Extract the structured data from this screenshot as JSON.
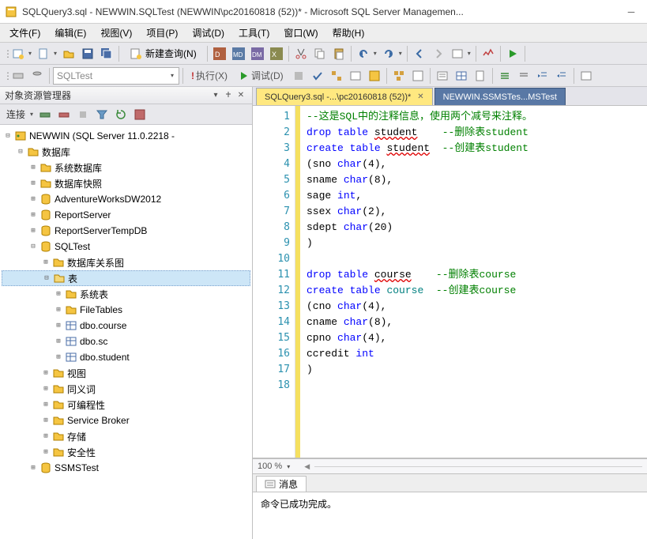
{
  "titlebar": {
    "text": "SQLQuery3.sql - NEWWIN.SQLTest (NEWWIN\\pc20160818 (52))* - Microsoft SQL Server Managemen..."
  },
  "menu": {
    "file": "文件(F)",
    "edit": "编辑(E)",
    "view": "视图(V)",
    "project": "项目(P)",
    "debug": "调试(D)",
    "tools": "工具(T)",
    "window": "窗口(W)",
    "help": "帮助(H)"
  },
  "toolbar1": {
    "new_query": "新建查询(N)"
  },
  "toolbar2": {
    "db_combo": "SQLTest",
    "execute": "执行(X)",
    "debug": "调试(D)"
  },
  "panel": {
    "title": "对象资源管理器",
    "connect_label": "连接"
  },
  "tree": {
    "server": "NEWWIN (SQL Server 11.0.2218 -",
    "databases": "数据库",
    "sys_db": "系统数据库",
    "db_snap": "数据库快照",
    "aw": "AdventureWorksDW2012",
    "rs": "ReportServer",
    "rstemp": "ReportServerTempDB",
    "sqltest": "SQLTest",
    "diagrams": "数据库关系图",
    "tables": "表",
    "sys_tables": "系统表",
    "filetables": "FileTables",
    "dbo_course": "dbo.course",
    "dbo_sc": "dbo.sc",
    "dbo_student": "dbo.student",
    "views": "视图",
    "synonyms": "同义词",
    "programmability": "可编程性",
    "servicebroker": "Service Broker",
    "storage": "存储",
    "security": "安全性",
    "ssmstest": "SSMSTest"
  },
  "tabs": {
    "t1": "SQLQuery3.sql -...\\pc20160818 (52))*",
    "t2": "NEWWIN.SSMSTes...MSTest"
  },
  "code": {
    "lines": [
      {
        "n": 1,
        "html": "<span class='kw-green'>--这是SQL中的注释信息，使用两个减号来注释。</span>"
      },
      {
        "n": 2,
        "html": "<span class='kw-blue'>drop</span> <span class='kw-blue'>table</span> <span class='err'>student</span>    <span class='kw-green'>--删除表student</span>"
      },
      {
        "n": 3,
        "html": "<span class='kw-blue'>create</span> <span class='kw-blue'>table</span> <span class='err'>student</span>  <span class='kw-green'>--创建表student</span>"
      },
      {
        "n": 4,
        "html": "(sno <span class='kw-blue'>char</span>(4),"
      },
      {
        "n": 5,
        "html": "sname <span class='kw-blue'>char</span>(8),"
      },
      {
        "n": 6,
        "html": "sage <span class='kw-blue'>int</span>,"
      },
      {
        "n": 7,
        "html": "ssex <span class='kw-blue'>char</span>(2),"
      },
      {
        "n": 8,
        "html": "sdept <span class='kw-blue'>char</span>(20)"
      },
      {
        "n": 9,
        "html": ")"
      },
      {
        "n": 10,
        "html": ""
      },
      {
        "n": 11,
        "html": "<span class='kw-blue'>drop</span> <span class='kw-blue'>table</span> <span class='err'>course</span>    <span class='kw-green'>--删除表course</span>"
      },
      {
        "n": 12,
        "html": "<span class='kw-blue'>create</span> <span class='kw-blue'>table</span> <span class='kw-teal'>course</span>  <span class='kw-green'>--创建表course</span>"
      },
      {
        "n": 13,
        "html": "(cno <span class='kw-blue'>char</span>(4),"
      },
      {
        "n": 14,
        "html": "cname <span class='kw-blue'>char</span>(8),"
      },
      {
        "n": 15,
        "html": "cpno <span class='kw-blue'>char</span>(4),"
      },
      {
        "n": 16,
        "html": "ccredit <span class='kw-blue'>int</span>"
      },
      {
        "n": 17,
        "html": ")"
      },
      {
        "n": 18,
        "html": ""
      }
    ]
  },
  "zoom": "100 %",
  "messages": {
    "tab": "消息",
    "text": "命令已成功完成。"
  }
}
